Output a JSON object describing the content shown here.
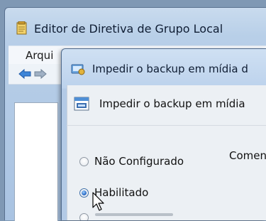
{
  "outer_window": {
    "title": "Editor de Diretiva de Grupo Local",
    "menu_first": "Arqui"
  },
  "dialog": {
    "title": "Impedir o backup em mídia d",
    "header": "Impedir o backup em mídia",
    "comment_label": "Comen",
    "options": [
      {
        "label": "Não Configurado",
        "checked": false
      },
      {
        "label": "Habilitado",
        "checked": true
      }
    ]
  },
  "icons": [
    "notepad-icon",
    "back-arrow-icon",
    "forward-arrow-icon",
    "policy-dialog-icon",
    "policy-setting-icon",
    "mouse-cursor-icon"
  ]
}
